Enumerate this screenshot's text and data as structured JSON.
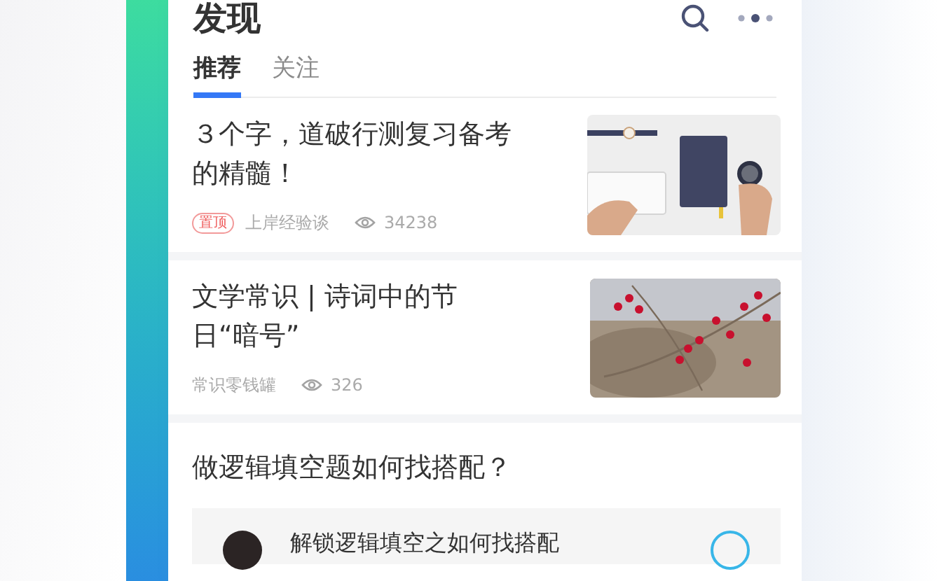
{
  "header": {
    "title": "发现"
  },
  "tabs": [
    {
      "label": "推荐",
      "selected": true
    },
    {
      "label": "关注",
      "selected": false
    }
  ],
  "articles": [
    {
      "title": "３个字，道破行测复习备考的精髓！",
      "pinned_badge": "置顶",
      "source": "上岸经验谈",
      "views": "34238"
    },
    {
      "title": "文学常识 | 诗词中的节日“暗号”",
      "source": "常识零钱罐",
      "views": "326"
    },
    {
      "kind": "question",
      "title": "做逻辑填空题如何找搭配？",
      "answer": {
        "title": "解锁逻辑填空之如何找搭配"
      }
    }
  ]
}
